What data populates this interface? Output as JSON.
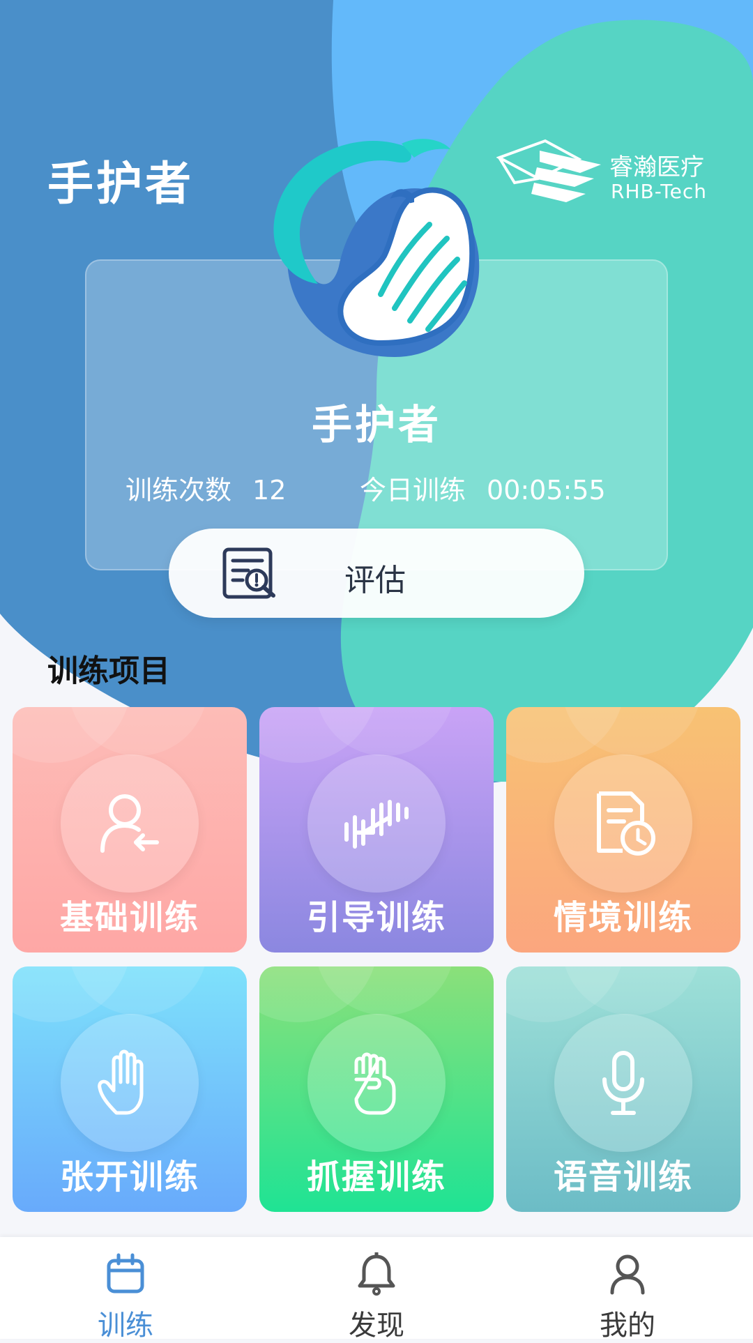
{
  "header": {
    "app_title": "手护者",
    "brand_cn": "睿瀚医疗",
    "brand_en": "RHB-Tech"
  },
  "profile_card": {
    "name": "手护者",
    "train_count_label": "训练次数",
    "train_count_value": "12",
    "today_label": "今日训练",
    "today_value": "00:05:55",
    "assess_label": "评估"
  },
  "section": {
    "title": "训练项目"
  },
  "tiles": [
    {
      "label": "基础训练",
      "icon": "person-return-icon"
    },
    {
      "label": "引导训练",
      "icon": "dumbbell-icon"
    },
    {
      "label": "情境训练",
      "icon": "document-clock-icon"
    },
    {
      "label": "张开训练",
      "icon": "open-hand-icon"
    },
    {
      "label": "抓握训练",
      "icon": "fist-icon"
    },
    {
      "label": "语音训练",
      "icon": "microphone-icon"
    }
  ],
  "tabbar": {
    "items": [
      {
        "label": "训练",
        "icon": "calendar-icon",
        "active": true
      },
      {
        "label": "发现",
        "icon": "bell-icon",
        "active": false
      },
      {
        "label": "我的",
        "icon": "person-icon",
        "active": false
      }
    ]
  },
  "colors": {
    "hero_blue": "#4a8fc9",
    "hero_light_blue": "#63b9fa",
    "hero_teal": "#56d4c4",
    "active_tab": "#4a8fd6"
  }
}
